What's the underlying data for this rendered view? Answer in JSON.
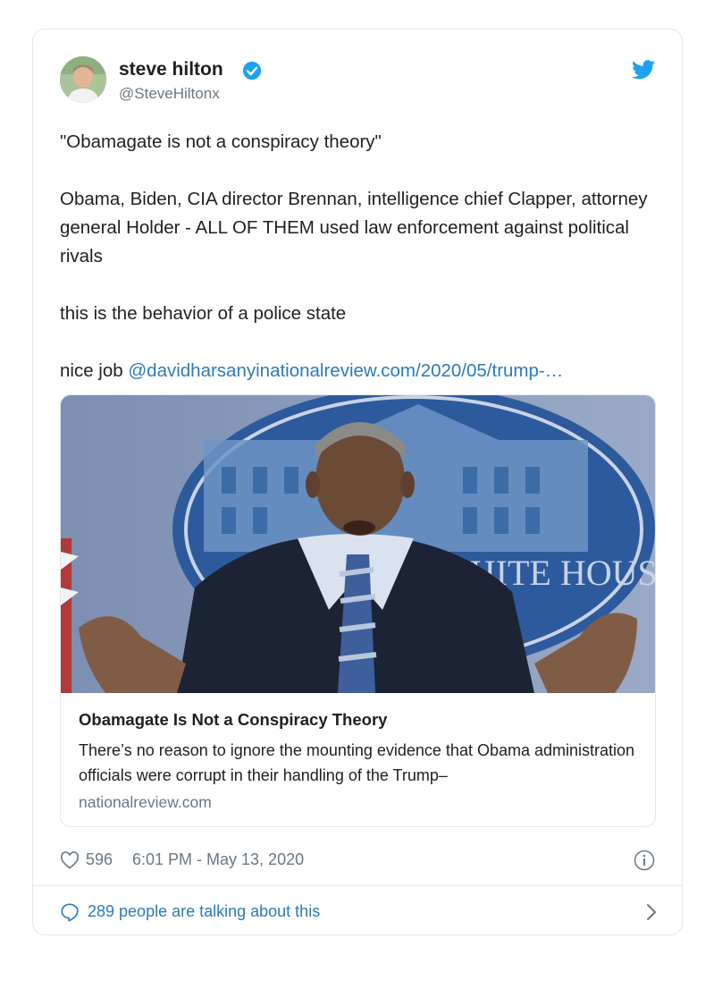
{
  "author": {
    "name": "steve hilton",
    "handle": "@SteveHiltonx",
    "verified": true
  },
  "tweet": {
    "line1": "\"Obamagate is not a conspiracy theory\"",
    "line2": "Obama, Biden, CIA director Brennan, intelligence chief Clapper, attorney general Holder - ALL OF THEM used law enforcement against political rivals",
    "line3": "this is the behavior of a police state",
    "line4_prefix": "nice job ",
    "mention": "@davidharsanyi",
    "link": "nationalreview.com/2020/05/trump-…"
  },
  "card": {
    "image_text": "WHITE HOUSE",
    "title": "Obamagate Is Not a Conspiracy Theory",
    "description": "There’s no reason to ignore the mounting evidence that Obama administration officials were corrupt in their handling of the Trump–",
    "domain": "nationalreview.com"
  },
  "footer": {
    "likes": "596",
    "timestamp": "6:01 PM - May 13, 2020",
    "talking": "289 people are talking about this"
  },
  "colors": {
    "link": "#2b7bb9",
    "verified": "#1da1f2",
    "muted": "#697882",
    "border": "#e1e8ed"
  },
  "icons": [
    "verified-icon",
    "twitter-bird-icon",
    "like-icon",
    "info-icon",
    "reply-icon",
    "chevron-right-icon"
  ]
}
